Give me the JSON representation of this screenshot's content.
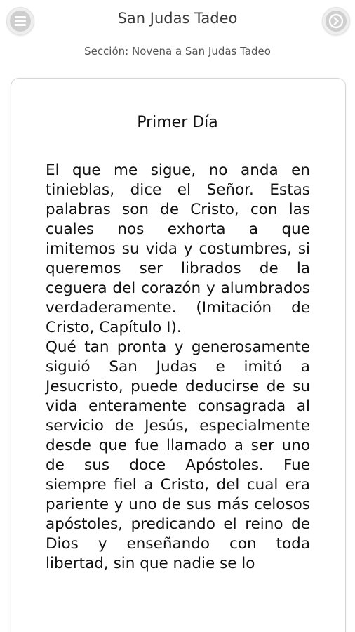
{
  "header": {
    "title": "San Judas Tadeo",
    "menu_icon": "menu-icon",
    "back_icon": "back-arrow-icon"
  },
  "section": {
    "label": "Sección: Novena a San Judas Tadeo"
  },
  "content": {
    "day_title": "Primer Día",
    "paragraphs": [
      "El que me sigue, no anda en tinieblas, dice el Señor. Estas palabras son de Cristo, con las cuales nos exhorta a que imitemos su vida y costumbres, si queremos ser librados de la ceguera del corazón y alumbrados verdaderamente. (Imitación de Cristo, Capítulo I).",
      "Qué tan pronta y generosamente siguió San Judas e imitó a Jesucristo, puede deducirse de su vida enteramente consagrada al servicio de Jesús, especialmente desde que fue llamado a ser uno de sus doce Apóstoles. Fue siempre fiel a Cristo, del cual era pariente y uno de sus más celosos apóstoles, predicando el reino de Dios y enseñando con toda libertad, sin que nadie se lo"
    ]
  },
  "colors": {
    "button_outer": "#efefef",
    "button_inner": "#cfcfcf",
    "card_border": "#d6d6d6"
  }
}
